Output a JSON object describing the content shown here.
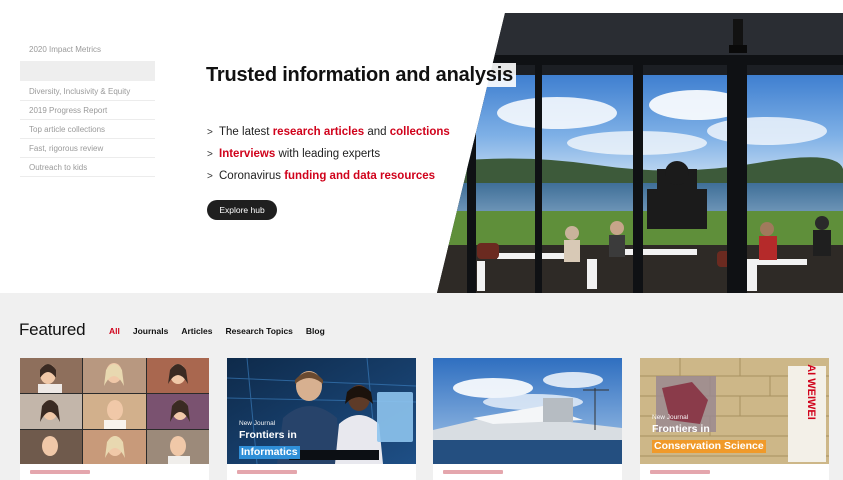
{
  "side_nav": {
    "items": [
      {
        "label": "2020 Impact Metrics"
      },
      {
        "label": ""
      },
      {
        "label": "Diversity, Inclusivity & Equity"
      },
      {
        "label": "2019 Progress Report"
      },
      {
        "label": "Top article collections"
      },
      {
        "label": "Fast, rigorous review"
      },
      {
        "label": "Outreach to kids"
      }
    ]
  },
  "hero": {
    "title": "Trusted information and analysis",
    "bullets": [
      {
        "pre": "The latest ",
        "hl1": "research articles",
        "mid": " and ",
        "hl2": "collections"
      },
      {
        "hl1": "Interviews",
        "post": " with leading experts"
      },
      {
        "pre": "Coronavirus ",
        "hl1": "funding and data resources"
      }
    ],
    "cta_label": "Explore hub"
  },
  "featured": {
    "title": "Featured",
    "tabs": [
      {
        "label": "All",
        "active": true
      },
      {
        "label": "Journals"
      },
      {
        "label": "Articles"
      },
      {
        "label": "Research Topics"
      },
      {
        "label": "Blog"
      }
    ],
    "cards": [
      {
        "overlay_sub": "",
        "overlay_name": ""
      },
      {
        "overlay_sub": "New Journal",
        "overlay_line1": "Frontiers in",
        "overlay_line2": "Informatics"
      },
      {
        "overlay_sub": "",
        "overlay_name": ""
      },
      {
        "overlay_sub": "New Journal",
        "overlay_line1": "Frontiers in",
        "overlay_line2": "Conservation Science",
        "sign_text": "AI WEIWEI"
      }
    ]
  },
  "colors": {
    "accent_red": "#d0021b",
    "informatics_highlight": "#2f8fd8",
    "conservation_highlight": "#f09a2a",
    "featured_bg": "#f0f0f0"
  }
}
